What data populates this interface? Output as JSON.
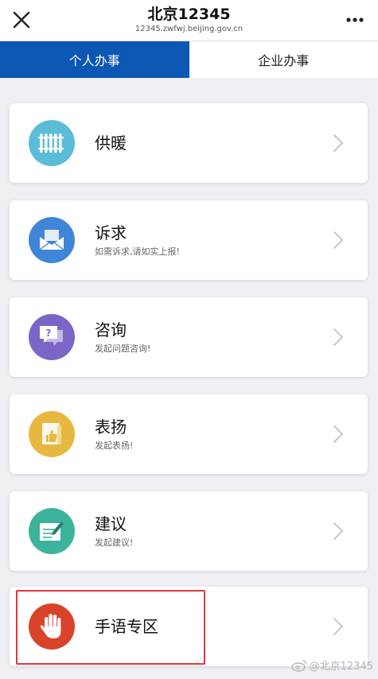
{
  "header": {
    "title": "北京12345",
    "subtitle": "12345.zwfwj.beijing.gov.cn",
    "close_icon": "close-icon",
    "more_icon": "more-dots-icon"
  },
  "tabs": [
    {
      "label": "个人办事",
      "active": true
    },
    {
      "label": "企业办事",
      "active": false
    }
  ],
  "items": [
    {
      "label": "供暖",
      "desc": "",
      "icon": "radiator-icon",
      "color": "#5bbcd8"
    },
    {
      "label": "诉求",
      "desc": "如需诉求,请如实上报!",
      "icon": "mail-icon",
      "color": "#3f86d9"
    },
    {
      "label": "咨询",
      "desc": "发起问题咨询!",
      "icon": "question-chat-icon",
      "color": "#7b66c7"
    },
    {
      "label": "表扬",
      "desc": "发起表扬!",
      "icon": "thumbs-up-icon",
      "color": "#e7b83f"
    },
    {
      "label": "建议",
      "desc": "发起建议!",
      "icon": "pencil-note-icon",
      "color": "#3cb39c"
    },
    {
      "label": "手语专区",
      "desc": "",
      "icon": "hand-icon",
      "color": "#d9432a"
    }
  ],
  "watermark": "@北京12345",
  "colors": {
    "tab_active": "#0b57b3",
    "highlight": "#e2363c"
  }
}
